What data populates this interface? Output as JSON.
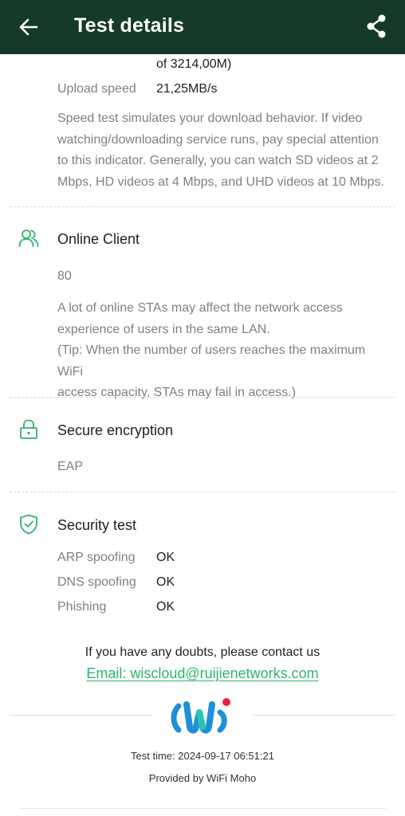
{
  "header": {
    "title": "Test details",
    "back_icon": "arrow-left-icon",
    "share_icon": "share-icon",
    "background": "#153a29"
  },
  "speed": {
    "download_tail": "of 3214,00M)",
    "upload_label": "Upload speed",
    "upload_value": "21,25MB/s",
    "description_lines": [
      "Speed test simulates your download behavior. If video",
      "watching/downloading service runs, pay special attention",
      "to this indicator. Generally, you can watch SD videos at 2",
      "Mbps, HD videos at 4 Mbps, and UHD videos at 10 Mbps."
    ]
  },
  "online_client": {
    "icon": "users-icon",
    "title": "Online Client",
    "value": "80",
    "description_lines": [
      "A lot of online STAs may affect the network access",
      "experience of users in the same LAN.",
      "(Tip: When the number of users reaches the maximum WiFi",
      "access capacity, STAs may fail in access.)"
    ]
  },
  "encryption": {
    "icon": "lock-icon",
    "title": "Secure encryption",
    "value": "EAP"
  },
  "security_test": {
    "icon": "shield-check-icon",
    "title": "Security test",
    "items": [
      {
        "label": "ARP spoofing",
        "value": "OK"
      },
      {
        "label": "DNS spoofing",
        "value": "OK"
      },
      {
        "label": "Phishing",
        "value": "OK"
      }
    ]
  },
  "contact": {
    "text": "If you have any doubts, please contact us",
    "email_link": "Email: wiscloud@ruijienetworks.com"
  },
  "footer": {
    "logo": "wifi-moho-logo",
    "test_time": "Test time: 2024-09-17 06:51:21",
    "provided_by": "Provided by WiFi Moho"
  },
  "colors": {
    "accent": "#2fb36d",
    "logo_blue": "#1f8fd8",
    "logo_teal": "#2cc4b0",
    "logo_red": "#e5243b"
  }
}
